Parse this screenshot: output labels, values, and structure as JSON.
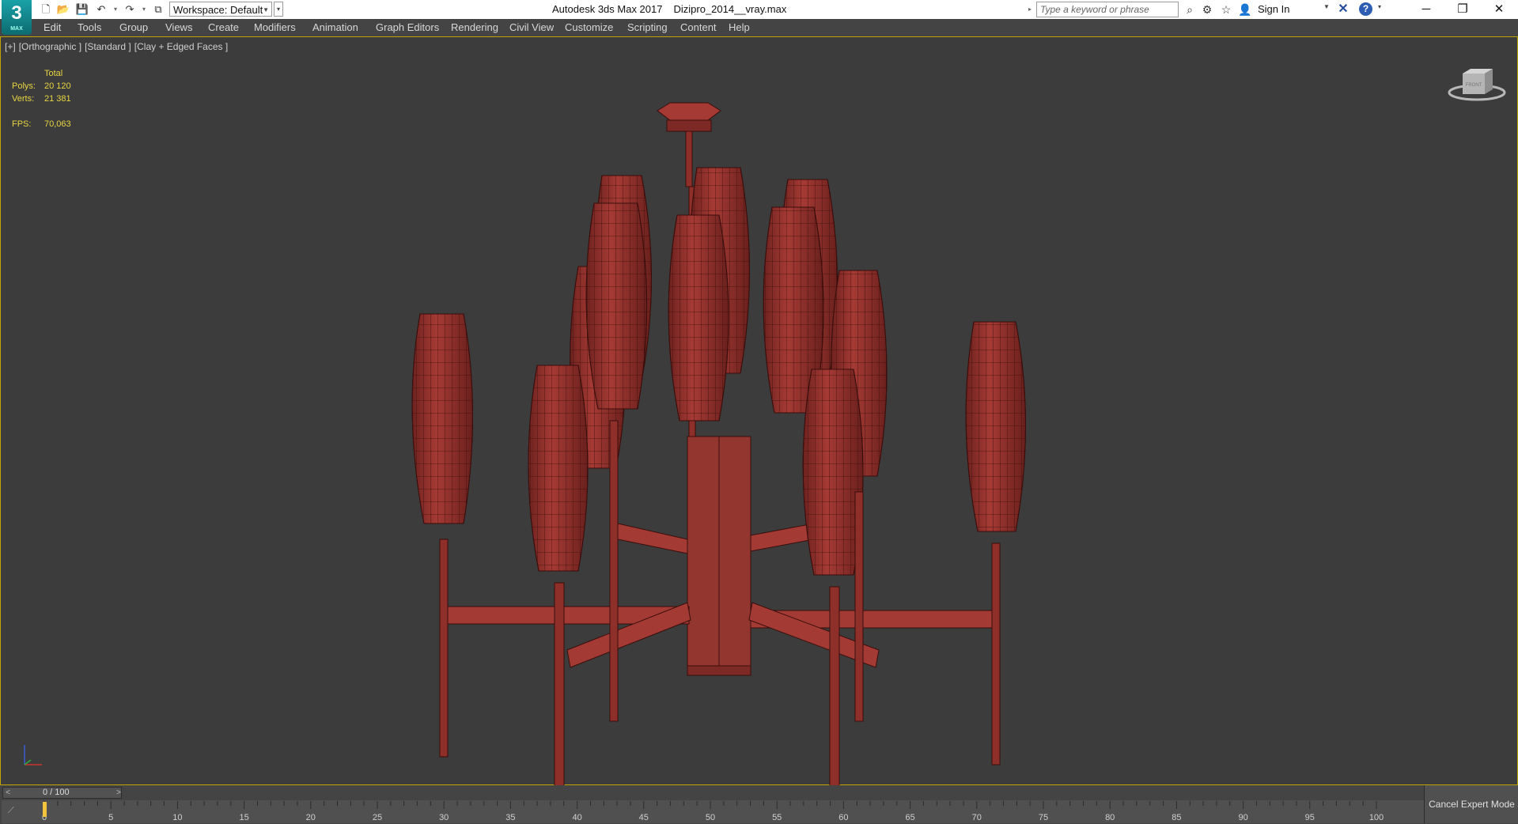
{
  "app": {
    "logo_text": "3",
    "logo_sub": "MAX",
    "window_title": "Autodesk 3ds Max 2017",
    "file_name": "Dizipro_2014__vray.max",
    "workspace": "Workspace: Default"
  },
  "search": {
    "placeholder": "Type a keyword or phrase"
  },
  "account": {
    "sign_in": "Sign In"
  },
  "menu": [
    "Edit",
    "Tools",
    "Group",
    "Views",
    "Create",
    "Modifiers",
    "Animation",
    "Graph Editors",
    "Rendering",
    "Civil View",
    "Customize",
    "Scripting",
    "Content",
    "Help"
  ],
  "viewport": {
    "labels": [
      "[+]",
      "[Orthographic ]",
      "[Standard ]",
      "[Clay + Edged Faces ]"
    ],
    "stats": {
      "header": "Total",
      "polys_label": "Polys:",
      "polys": "20 120",
      "verts_label": "Verts:",
      "verts": "21 381",
      "fps_label": "FPS:",
      "fps": "70,063"
    },
    "viewcube_label": "FRONT"
  },
  "timeline": {
    "slider": "0 / 100",
    "ticks": [
      "0",
      "5",
      "10",
      "15",
      "20",
      "25",
      "30",
      "35",
      "40",
      "45",
      "50",
      "55",
      "60",
      "65",
      "70",
      "75",
      "80",
      "85",
      "90",
      "95",
      "100"
    ],
    "current_frame": 0,
    "total_frames": 100,
    "expert_mode": "Cancel Expert Mode"
  },
  "colors": {
    "accent": "#c1a300",
    "viewport_bg": "#3c3c3c",
    "model": "#9a3530",
    "stats_text": "#e8d640"
  }
}
